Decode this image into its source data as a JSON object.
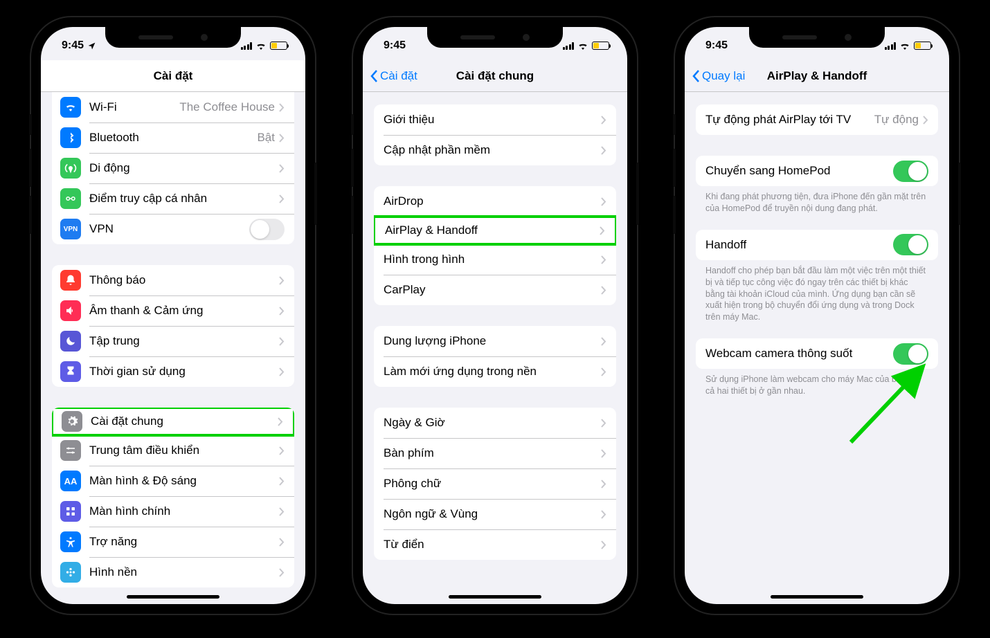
{
  "status": {
    "time": "9:45"
  },
  "phone1": {
    "title": "Cài đặt",
    "rows": {
      "wifi": {
        "label": "Wi-Fi",
        "detail": "The Coffee House"
      },
      "bluetooth": {
        "label": "Bluetooth",
        "detail": "Bật"
      },
      "cellular": {
        "label": "Di động"
      },
      "hotspot": {
        "label": "Điểm truy cập cá nhân"
      },
      "vpn": {
        "label": "VPN"
      },
      "notifications": {
        "label": "Thông báo"
      },
      "sound": {
        "label": "Âm thanh & Cảm ứng"
      },
      "focus": {
        "label": "Tập trung"
      },
      "screentime": {
        "label": "Thời gian sử dụng"
      },
      "general": {
        "label": "Cài đặt chung"
      },
      "control": {
        "label": "Trung tâm điều khiển"
      },
      "display": {
        "label": "Màn hình & Độ sáng"
      },
      "home": {
        "label": "Màn hình chính"
      },
      "accessibility": {
        "label": "Trợ năng"
      },
      "wallpaper": {
        "label": "Hình nền"
      }
    }
  },
  "phone2": {
    "back": "Cài đặt",
    "title": "Cài đặt chung",
    "rows": {
      "about": "Giới thiệu",
      "update": "Cập nhật phần mềm",
      "airdrop": "AirDrop",
      "airplay": "AirPlay & Handoff",
      "pip": "Hình trong hình",
      "carplay": "CarPlay",
      "storage": "Dung lượng iPhone",
      "bgrefresh": "Làm mới ứng dụng trong nền",
      "datetime": "Ngày & Giờ",
      "keyboard": "Bàn phím",
      "fonts": "Phông chữ",
      "language": "Ngôn ngữ & Vùng",
      "dictionary": "Từ điển"
    }
  },
  "phone3": {
    "back": "Quay lại",
    "title": "AirPlay & Handoff",
    "rows": {
      "auto": {
        "label": "Tự động phát AirPlay tới TV",
        "detail": "Tự động"
      },
      "homepod": {
        "label": "Chuyển sang HomePod",
        "footer": "Khi đang phát phương tiện, đưa iPhone đến gần mặt trên của HomePod để truyền nội dung đang phát."
      },
      "handoff": {
        "label": "Handoff",
        "footer": "Handoff cho phép bạn bắt đầu làm một việc trên một thiết bị và tiếp tục công việc đó ngay trên các thiết bị khác bằng tài khoản iCloud của mình. Ứng dụng bạn cần sẽ xuất hiện trong bộ chuyển đổi ứng dụng và trong Dock trên máy Mac."
      },
      "webcam": {
        "label": "Webcam camera thông suốt",
        "footer": "Sử dụng iPhone làm webcam cho máy Mac của bạn khi cả hai thiết bị ở gần nhau."
      }
    }
  }
}
